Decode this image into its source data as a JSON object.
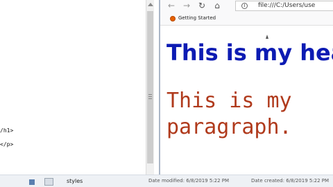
{
  "editor": {
    "lines": [
      "/h1>",
      "</p>"
    ]
  },
  "browser": {
    "url": "file:///C:/Users/use",
    "bookmarks": [
      {
        "label": "Getting Started",
        "icon": "firefox-icon"
      }
    ],
    "page": {
      "heading": "This is my hea",
      "paragraph": "This is my paragraph.",
      "heading_color": "#0c1bb3",
      "paragraph_color": "#b03a1c"
    }
  },
  "explorer": {
    "file_name": "styles",
    "date_modified": "Date modified: 6/8/2019 5:22 PM",
    "date_created": "Date created: 6/8/2019 5:22 PM"
  },
  "icons": {
    "back": "back-arrow-icon",
    "forward": "forward-arrow-icon",
    "reload": "reload-icon",
    "home": "home-icon",
    "info": "info-icon"
  }
}
